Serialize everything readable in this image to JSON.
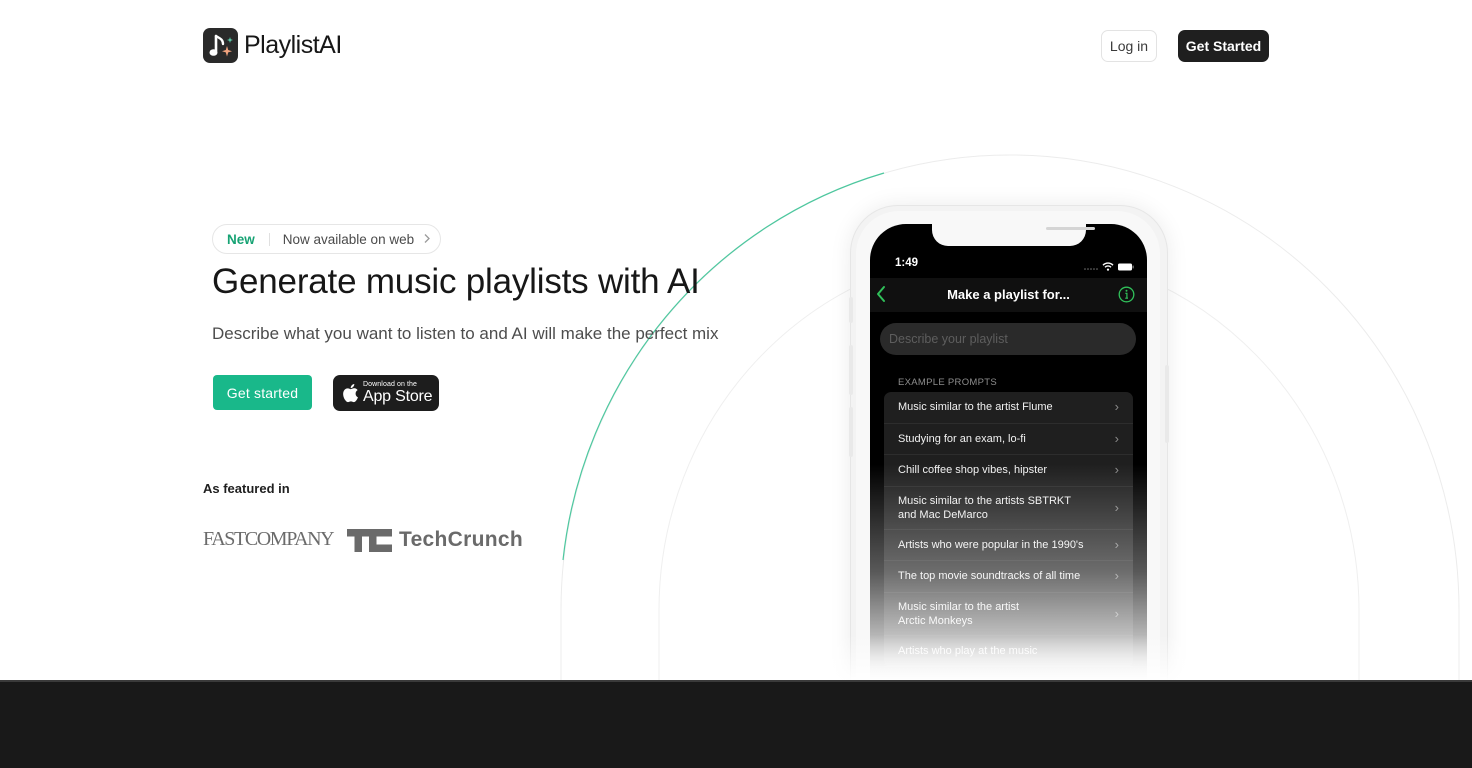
{
  "header": {
    "brand_name": "PlaylistAI",
    "login_label": "Log in",
    "get_started_label": "Get Started"
  },
  "hero": {
    "badge_new": "New",
    "badge_text": "Now available on web",
    "title": "Generate music playlists with AI",
    "subtitle": "Describe what you want to listen to and AI will make the perfect mix",
    "cta_label": "Get started",
    "appstore_small": "Download on the",
    "appstore_big": "App Store"
  },
  "featured": {
    "label": "As featured in",
    "logos": [
      "FAST COMPANY",
      "TechCrunch"
    ],
    "fastco_text": "FASTCOMPANY",
    "techcrunch_text": "TechCrunch"
  },
  "phone": {
    "time": "1:49",
    "nav_title": "Make a playlist for...",
    "search_placeholder": "Describe your playlist",
    "prompts_label": "EXAMPLE PROMPTS",
    "prompts": [
      {
        "line1": "Music similar to the artist Flume",
        "line2": ""
      },
      {
        "line1": "Studying for an exam, lo-fi",
        "line2": ""
      },
      {
        "line1": "Chill coffee shop vibes, hipster",
        "line2": ""
      },
      {
        "line1": "Music similar to the artists SBTRKT",
        "line2": "and Mac DeMarco"
      },
      {
        "line1": "Artists who were popular in the 1990's",
        "line2": ""
      },
      {
        "line1": "The top movie soundtracks of all time",
        "line2": ""
      },
      {
        "line1": "Music similar to the artist",
        "line2": "Arctic Monkeys"
      },
      {
        "line1": "Artists who play at the music",
        "line2": ""
      }
    ]
  },
  "colors": {
    "accent_green": "#19b88a",
    "badge_green": "#17a374",
    "ios_green": "#30d158",
    "dark": "#1f1f1f",
    "footer_dark": "#191919"
  },
  "icons": {
    "logo": "music-note-sparkle-icon",
    "pill_chevron": "chevron-right-icon",
    "appstore": "apple-icon",
    "back": "chevron-left-icon",
    "info": "info-circle-icon",
    "wifi": "wifi-icon",
    "battery": "battery-icon",
    "row_chevron": "chevron-right-icon"
  }
}
